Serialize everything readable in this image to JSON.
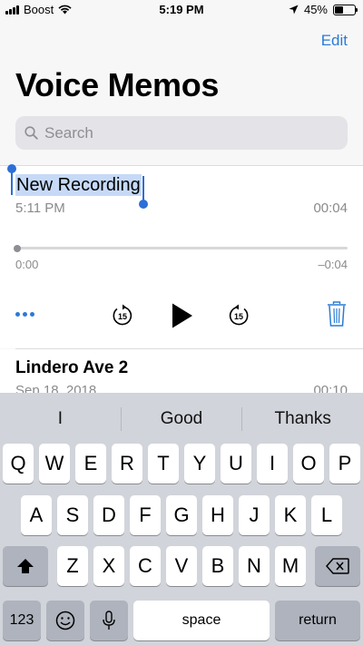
{
  "status_bar": {
    "carrier": "Boost",
    "time": "5:19 PM",
    "battery": "45%",
    "battery_level": 0.45
  },
  "header": {
    "edit_label": "Edit",
    "title": "Voice Memos"
  },
  "search": {
    "placeholder": "Search"
  },
  "selected_recording": {
    "title": "New Recording",
    "date": "5:11 PM",
    "duration": "00:04",
    "elapsed": "0:00",
    "remaining": "–0:04",
    "skip_back_seconds": "15",
    "skip_forward_seconds": "15"
  },
  "recordings": [
    {
      "name": "Lindero Ave 2",
      "date": "Sep 18, 2018",
      "duration": "00:10"
    }
  ],
  "keyboard": {
    "suggestions": [
      "I",
      "Good",
      "Thanks"
    ],
    "rows": [
      [
        "Q",
        "W",
        "E",
        "R",
        "T",
        "Y",
        "U",
        "I",
        "O",
        "P"
      ],
      [
        "A",
        "S",
        "D",
        "F",
        "G",
        "H",
        "J",
        "K",
        "L"
      ],
      [
        "Z",
        "X",
        "C",
        "V",
        "B",
        "N",
        "M"
      ]
    ],
    "numbers_label": "123",
    "space_label": "space",
    "return_label": "return"
  },
  "colors": {
    "accent": "#2a7bd6",
    "selection": "#c6daf7",
    "keyboard_bg": "#d1d4da"
  }
}
